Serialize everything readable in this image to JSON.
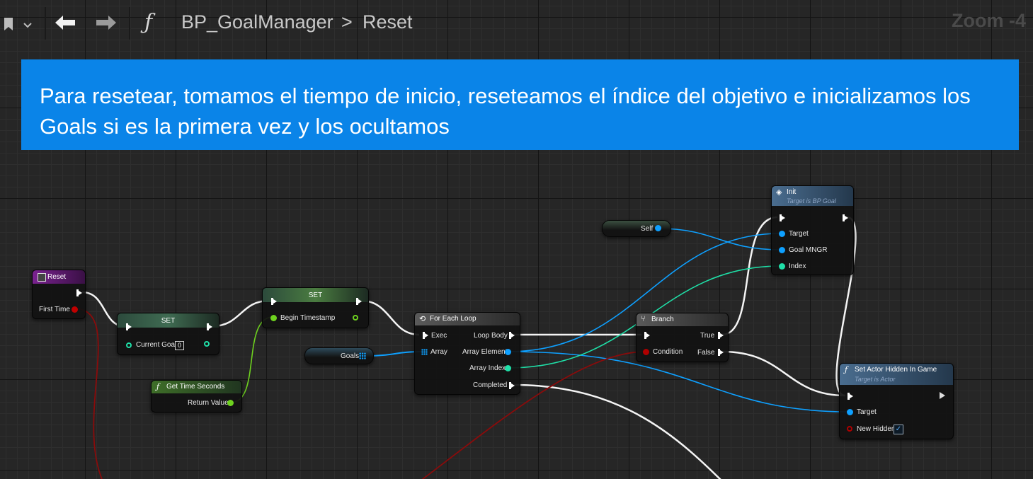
{
  "toolbar": {
    "bookmark_icon": "bookmark-icon",
    "dropdown_icon": "chevron-down-icon",
    "back_icon": "arrow-left-icon",
    "forward_icon": "arrow-right-icon",
    "function_icon": "function-icon",
    "breadcrumb_blueprint": "BP_GoalManager",
    "breadcrumb_separator": ">",
    "breadcrumb_function": "Reset",
    "zoom": "Zoom -4"
  },
  "banner": {
    "text": "Para resetear, tomamos el tiempo de inicio, reseteamos el índice del objetivo e inicializamos los Goals si es la primera vez y los ocultamos",
    "color": "#0a84e8"
  },
  "nodes": {
    "reset": {
      "title": "Reset",
      "pin_first_time": "First Time"
    },
    "set_current_goal": {
      "title": "SET",
      "pin_label": "Current Goal",
      "pin_value": "0"
    },
    "set_begin_timestamp": {
      "title": "SET",
      "pin_label": "Begin Timestamp"
    },
    "get_time_seconds": {
      "title": "Get Time Seconds",
      "pin_return": "Return Value"
    },
    "goals": {
      "label": "Goals"
    },
    "self": {
      "label": "Self"
    },
    "for_each_loop": {
      "title": "For Each Loop",
      "pin_exec": "Exec",
      "pin_array": "Array",
      "pin_loop_body": "Loop Body",
      "pin_array_element": "Array Element",
      "pin_array_index": "Array Index",
      "pin_completed": "Completed"
    },
    "branch": {
      "title": "Branch",
      "pin_condition": "Condition",
      "pin_true": "True",
      "pin_false": "False"
    },
    "init": {
      "title": "Init",
      "subtitle": "Target is BP Goal",
      "pin_target": "Target",
      "pin_goal_mngr": "Goal MNGR",
      "pin_index": "Index"
    },
    "set_actor_hidden": {
      "title": "Set Actor Hidden In Game",
      "subtitle": "Target is Actor",
      "pin_target": "Target",
      "pin_new_hidden": "New Hidden",
      "new_hidden_checked": "✓"
    }
  },
  "colors": {
    "exec": "#ffffff",
    "object": "#0ea0ff",
    "integer": "#1fe0a8",
    "float": "#8fe83a",
    "bool": "#9a0000",
    "function_header": "#4a6d8f",
    "event_header": "#7a2290",
    "set_header": "#3f6b52"
  }
}
